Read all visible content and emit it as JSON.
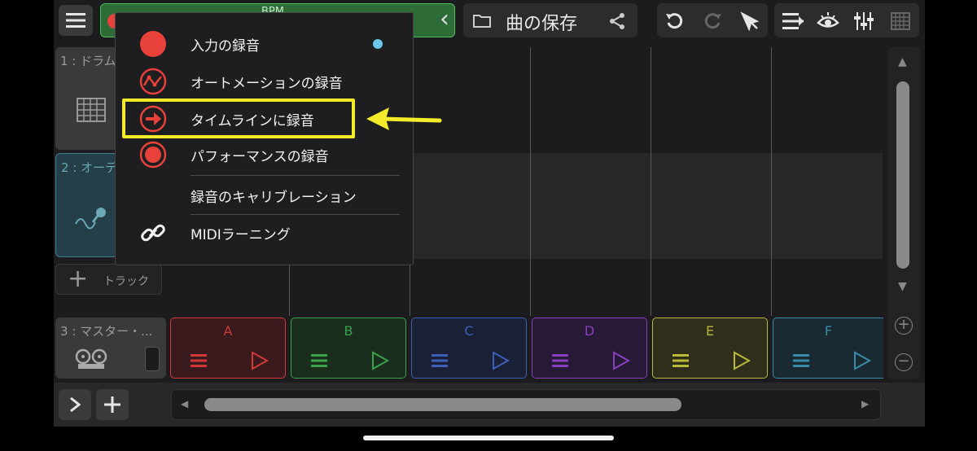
{
  "toolbar": {
    "bpm_label": "BPM",
    "save_label": "曲の保存",
    "chevron": "‹"
  },
  "tracks": [
    {
      "label": "1 : ドラム",
      "icon": "drum-grid-icon"
    },
    {
      "label": "2 : オーデ",
      "icon": "microphone-icon"
    },
    {
      "label": "3 : マスター・...",
      "icon": "tape-reel-icon"
    }
  ],
  "add_track_label": "トラック",
  "pads": [
    {
      "letter": "A",
      "color": "#d23a3a"
    },
    {
      "letter": "B",
      "color": "#3aa24a"
    },
    {
      "letter": "C",
      "color": "#3d5fb8"
    },
    {
      "letter": "D",
      "color": "#8a3fc0"
    },
    {
      "letter": "E",
      "color": "#b8b83a"
    },
    {
      "letter": "F",
      "color": "#3a8aaa"
    }
  ],
  "record_menu": {
    "items": [
      {
        "label": "入力の録音",
        "icon": "record-filled-icon"
      },
      {
        "label": "オートメーションの録音",
        "icon": "automation-curve-icon"
      },
      {
        "label": "タイムラインに録音",
        "icon": "arrow-right-circle-icon"
      },
      {
        "label": "パフォーマンスの録音",
        "icon": "record-ring-icon"
      },
      {
        "label": "録音のキャリブレーション",
        "icon": ""
      },
      {
        "label": "MIDIラーニング",
        "icon": "link-icon"
      }
    ]
  },
  "colors": {
    "accent_red": "#e8413a",
    "highlight_yellow": "#f3ea2a",
    "indicator_blue": "#6cc8ec",
    "bpm_green": "#2f8f3f"
  }
}
